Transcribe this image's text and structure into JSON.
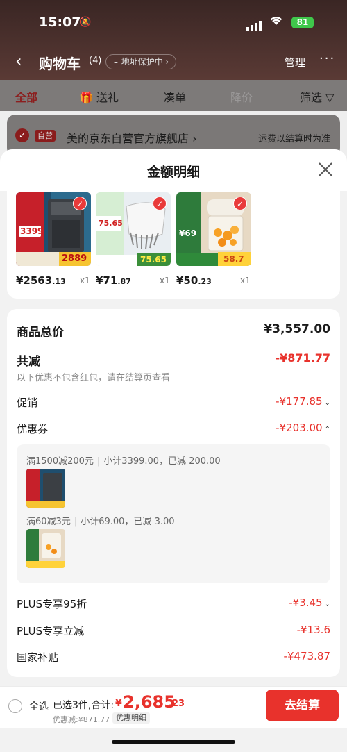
{
  "status_bar": {
    "time": "15:07",
    "battery": "81"
  },
  "header": {
    "title": "购物车",
    "count": "(4)",
    "address_protect": "地址保护中",
    "manage": "管理"
  },
  "tabs": [
    {
      "label": "全部"
    },
    {
      "label": "送礼"
    },
    {
      "label": "凑单"
    },
    {
      "label": "降价"
    },
    {
      "label": "筛选"
    }
  ],
  "store": {
    "badge": "自营",
    "name": "美的京东自营官方旗舰店",
    "arrow": "›",
    "shipping_note": "运费以结算时为准"
  },
  "sheet": {
    "title": "金额明细",
    "products": [
      {
        "price_int": "¥2563",
        "price_dec": ".13",
        "qty": "x1"
      },
      {
        "price_int": "¥71",
        "price_dec": ".87",
        "qty": "x1"
      },
      {
        "price_int": "¥50",
        "price_dec": ".23",
        "qty": "x1"
      }
    ],
    "thumb_texts": {
      "p1_price": "3399",
      "p1_sub": "2889",
      "p2_price": "75.65",
      "p2_sub": "75.65",
      "p3_price": "¥69",
      "p3_sub": "58.7"
    },
    "total_label": "商品总价",
    "total_value": "¥3,557.00",
    "reduce_label": "共减",
    "reduce_value": "-¥871.77",
    "reduce_note": "以下优惠不包含红包，请在结算页查看",
    "promo_label": "促销",
    "promo_value": "-¥177.85",
    "coupon_label": "优惠券",
    "coupon_value": "-¥203.00",
    "coupons": [
      {
        "rule": "满1500减200元",
        "detail": "小计3399.00，已减 200.00"
      },
      {
        "rule": "满60减3元",
        "detail": "小计69.00，已减 3.00"
      }
    ],
    "plus95_label": "PLUS专享95折",
    "plus95_value": "-¥3.45",
    "plus_instant_label": "PLUS专享立减",
    "plus_instant_value": "-¥13.6",
    "subsidy_label": "国家补贴",
    "subsidy_value": "-¥473.87"
  },
  "bottom": {
    "select_all": "全选",
    "selected": "已选3件,合计:",
    "currency": "¥",
    "total_int": "2,685",
    "total_dec": ".23",
    "discount": "优惠减:¥871.77",
    "detail_btn": "优惠明细",
    "checkout": "去结算"
  }
}
